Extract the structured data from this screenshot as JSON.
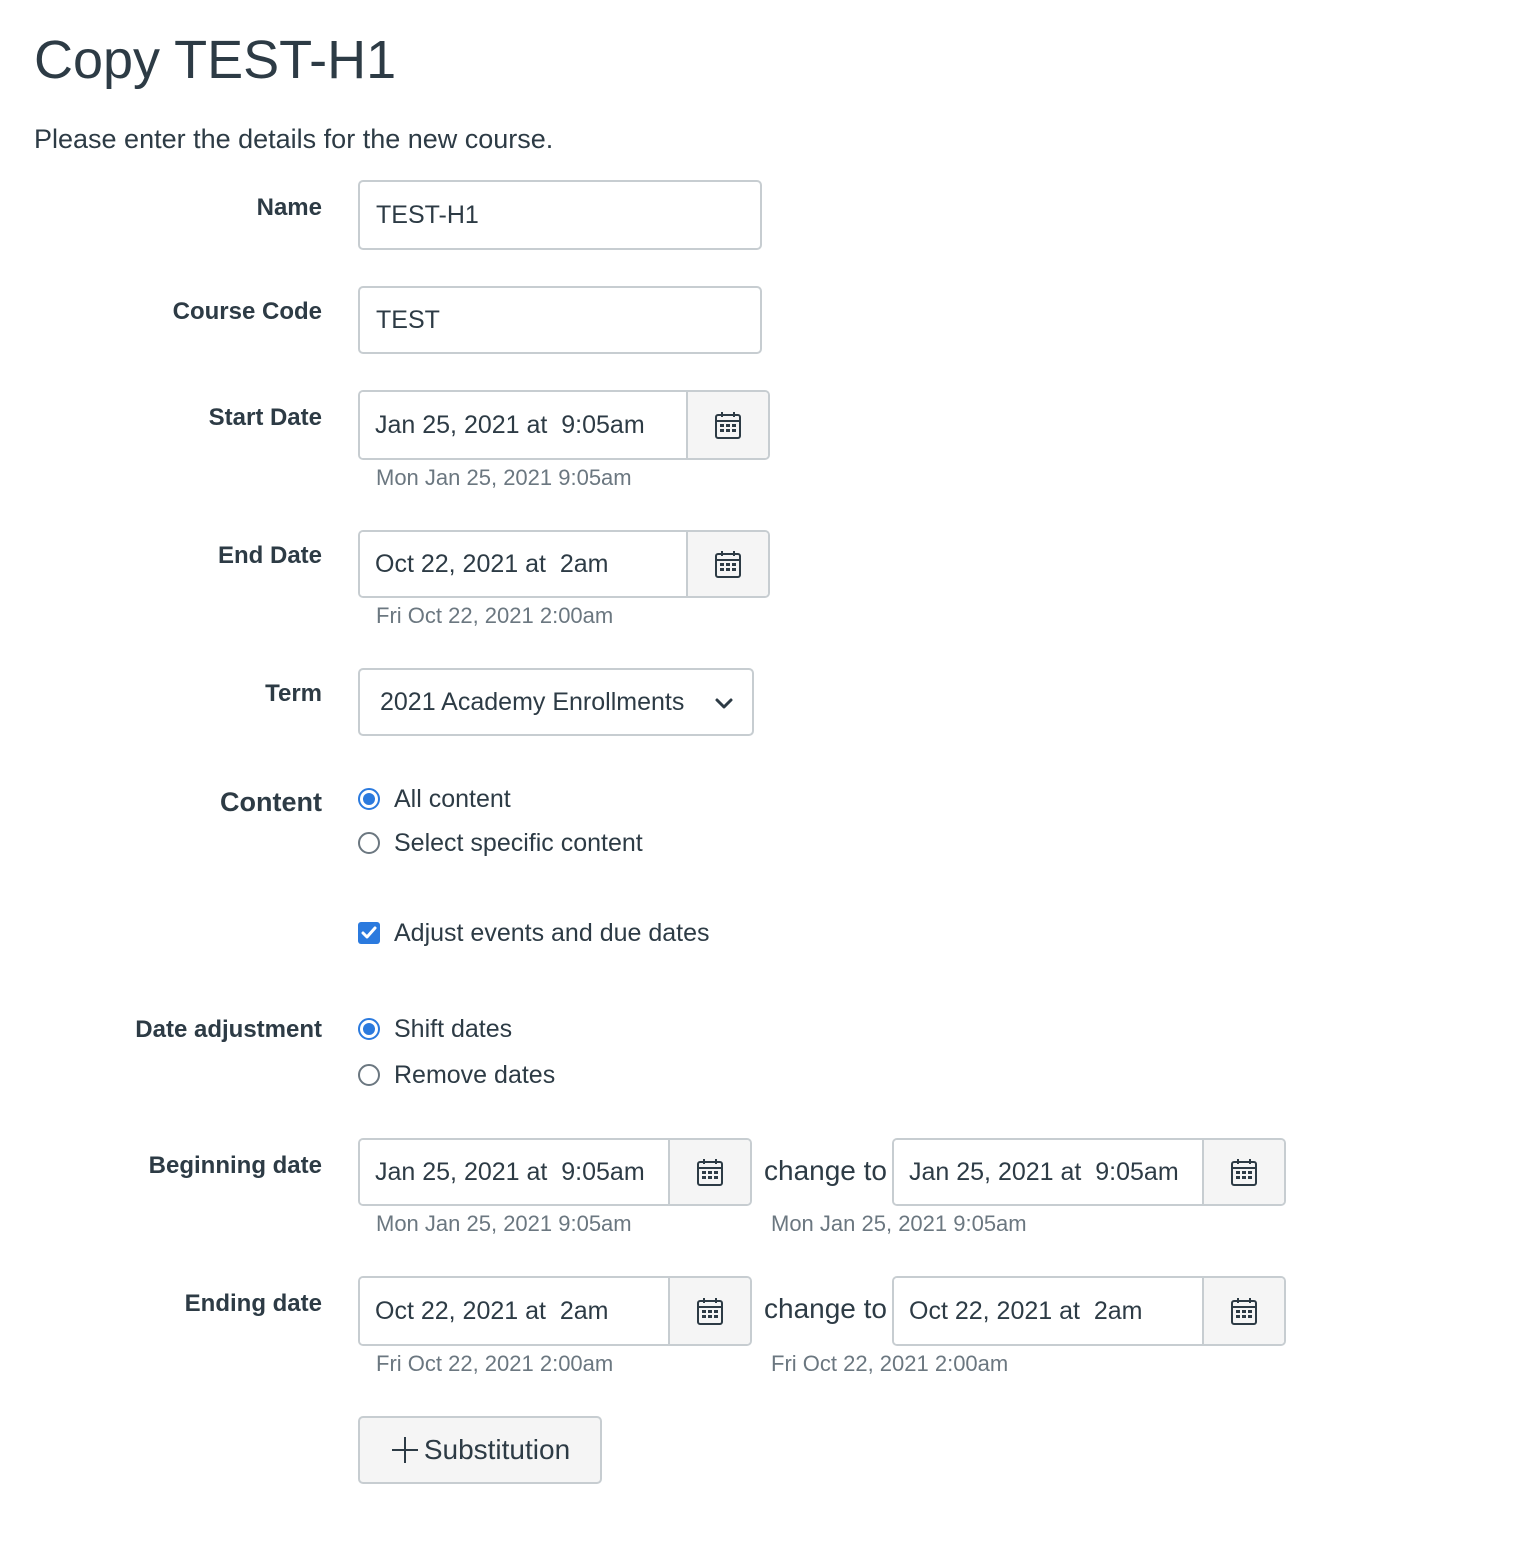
{
  "page": {
    "title": "Copy TEST-H1",
    "intro": "Please enter the details for the new course."
  },
  "form": {
    "name": {
      "label": "Name",
      "value": "TEST-H1"
    },
    "course_code": {
      "label": "Course Code",
      "value": "TEST"
    },
    "start_date": {
      "label": "Start Date",
      "value": "Jan 25, 2021 at  9:05am",
      "hint": "Mon Jan 25, 2021 9:05am",
      "icon": "calendar-icon"
    },
    "end_date": {
      "label": "End Date",
      "value": "Oct 22, 2021 at  2am",
      "hint": "Fri Oct 22, 2021 2:00am",
      "icon": "calendar-icon"
    },
    "term": {
      "label": "Term",
      "selected": "2021 Academy Enrollments",
      "icon": "chevron-down-icon"
    },
    "content": {
      "label": "Content",
      "options": [
        {
          "label": "All content",
          "checked": true
        },
        {
          "label": "Select specific content",
          "checked": false
        }
      ]
    },
    "adjust_dates": {
      "label": "Adjust events and due dates",
      "checked": true
    },
    "date_adjustment": {
      "label": "Date adjustment",
      "options": [
        {
          "label": "Shift dates",
          "checked": true
        },
        {
          "label": "Remove dates",
          "checked": false
        }
      ]
    },
    "beginning_date": {
      "label": "Beginning date",
      "from_value": "Jan 25, 2021 at  9:05am",
      "from_hint": "Mon Jan 25, 2021 9:05am",
      "change_to": "change to",
      "to_value": "Jan 25, 2021 at  9:05am",
      "to_hint": "Mon Jan 25, 2021 9:05am"
    },
    "ending_date": {
      "label": "Ending date",
      "from_value": "Oct 22, 2021 at  2am",
      "from_hint": "Fri Oct 22, 2021 2:00am",
      "change_to": "change to",
      "to_value": "Oct 22, 2021 at  2am",
      "to_hint": "Fri Oct 22, 2021 2:00am"
    },
    "substitution_button": {
      "label": "Substitution",
      "icon": "plus-icon"
    }
  },
  "colors": {
    "text": "#2d3b45",
    "hint": "#6b7780",
    "border": "#c7cdd1",
    "accent": "#2b7ade",
    "button_bg": "#f5f5f5"
  }
}
